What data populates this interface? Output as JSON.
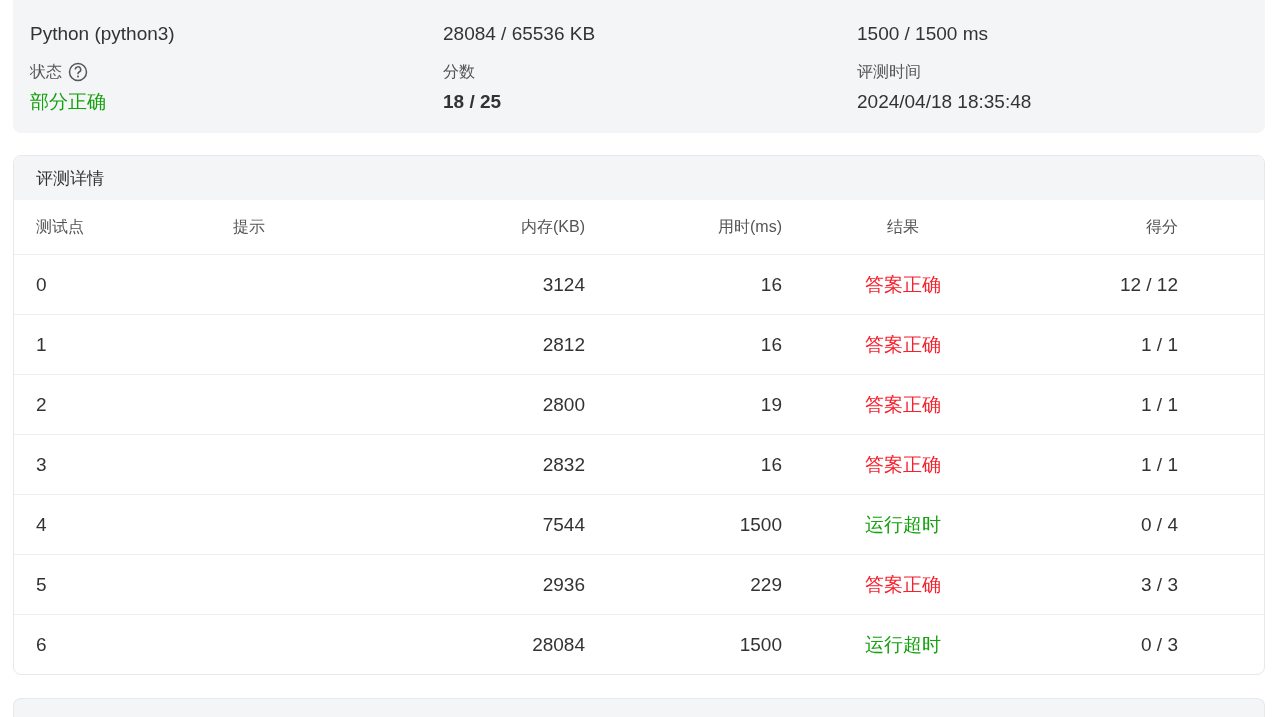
{
  "summary": {
    "fields": [
      {
        "value": "Python (python3)",
        "kind": "text"
      },
      {
        "value": "28084 / 65536 KB",
        "kind": "text"
      },
      {
        "value": "1500 / 1500 ms",
        "kind": "text"
      },
      {
        "label": "状态",
        "value": "部分正确",
        "kind": "status",
        "help": true,
        "color": "#13a10e"
      },
      {
        "label": "分数",
        "value": "18 / 25",
        "kind": "score"
      },
      {
        "label": "评测时间",
        "value": "2024/04/18 18:35:48",
        "kind": "text"
      }
    ]
  },
  "details": {
    "title": "评测详情",
    "columns": [
      "测试点",
      "提示",
      "内存(KB)",
      "用时(ms)",
      "结果",
      "得分"
    ],
    "rows": [
      {
        "case": "0",
        "memory": "3124",
        "time": "16",
        "result": "答案正确",
        "color": "#f5222d",
        "score": "12 / 12"
      },
      {
        "case": "1",
        "memory": "2812",
        "time": "16",
        "result": "答案正确",
        "color": "#f5222d",
        "score": "1 / 1"
      },
      {
        "case": "2",
        "memory": "2800",
        "time": "19",
        "result": "答案正确",
        "color": "#f5222d",
        "score": "1 / 1"
      },
      {
        "case": "3",
        "memory": "2832",
        "time": "16",
        "result": "答案正确",
        "color": "#f5222d",
        "score": "1 / 1"
      },
      {
        "case": "4",
        "memory": "7544",
        "time": "1500",
        "result": "运行超时",
        "color": "#13a10e",
        "score": "0 / 4"
      },
      {
        "case": "5",
        "memory": "2936",
        "time": "229",
        "result": "答案正确",
        "color": "#f5222d",
        "score": "3 / 3"
      },
      {
        "case": "6",
        "memory": "28084",
        "time": "1500",
        "result": "运行超时",
        "color": "#13a10e",
        "score": "0 / 3"
      }
    ]
  }
}
